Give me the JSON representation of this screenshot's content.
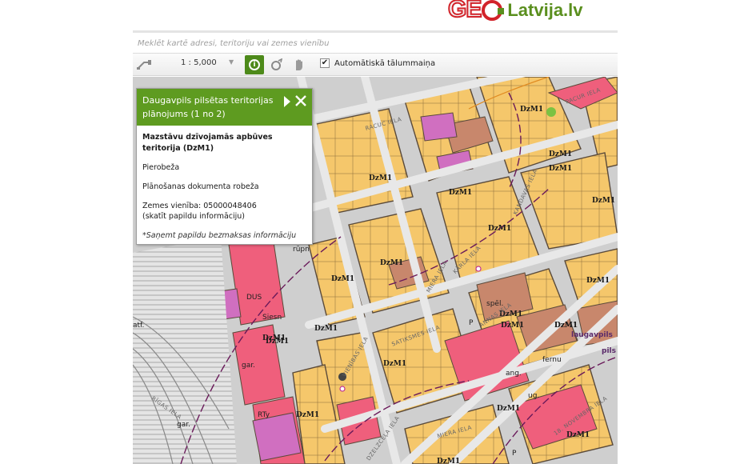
{
  "logo": {
    "geo_text": "GE",
    "brand_text": "Latvija.lv"
  },
  "search": {
    "placeholder": "Meklēt kartē adresi, teritoriju vai zemes vienību"
  },
  "toolbar": {
    "scale": "1 : 5,000",
    "auto_zoom_label": "Automātiskā tālummaiņa",
    "auto_zoom_checked": true,
    "info_icon": "info-icon",
    "identify_icon": "identify-icon",
    "pan_icon": "hand-icon",
    "measure_icon": "measure-icon"
  },
  "popup": {
    "title": "Daugavpils pilsētas teritorijas plānojums (1 no 2)",
    "zone": "Mazstāvu dzīvojamās apbūves teritorija (DzM1)",
    "boundary": "Pierobeža",
    "planning_boundary": "Plānošanas dokumenta robeža",
    "parcel_label": "Zemes vienība: 05000048406",
    "parcel_link": "(skatīt papildu informāciju)",
    "extra_info": "*Saņemt papildu bezmaksas informāciju"
  },
  "map": {
    "zone_labels": [
      "DzM1",
      "DzM1",
      "DzM1",
      "DzM1",
      "DzM1",
      "DzM1",
      "DzM1",
      "DzM1",
      "DzM1",
      "DzM1",
      "DzM1",
      "DzM1",
      "DzM1",
      "DzM1",
      "DzM1",
      "DzM1",
      "DzM1",
      "DzM1",
      "DzM1",
      "DzM1",
      "DzM1",
      "DzM1"
    ],
    "place_labels": [
      "rūpn",
      "DUS",
      "atf.",
      "gar.",
      "gar.",
      "RTy",
      "Siesn",
      "spēl.",
      "fernu",
      "ang.",
      "ug.",
      "P",
      "P",
      "laugavpils",
      "pils"
    ],
    "street_labels": [
      "PACUR IELA",
      "RACUC IELA",
      "MIERA IELA",
      "KĀRLA IELA",
      "ANNAS IELA",
      "SATIKSMES IELA",
      "18. NOVEMBRA IELA",
      "VIENĪBAS IELA",
      "RĪGAS IELA",
      "KANDAVAS IELA",
      "MIERA IELA",
      "DZELZCEĻA IELA"
    ]
  },
  "colors": {
    "accent": "#5e9b20",
    "residential": "#f5c76b",
    "mixed": "#c8876c",
    "commercial": "#ef5f7c",
    "industrial": "#d06fc0",
    "road": "#dadada",
    "building_outline": "#444444",
    "logo_red": "#d2232a",
    "logo_green": "#5a8f1e"
  }
}
